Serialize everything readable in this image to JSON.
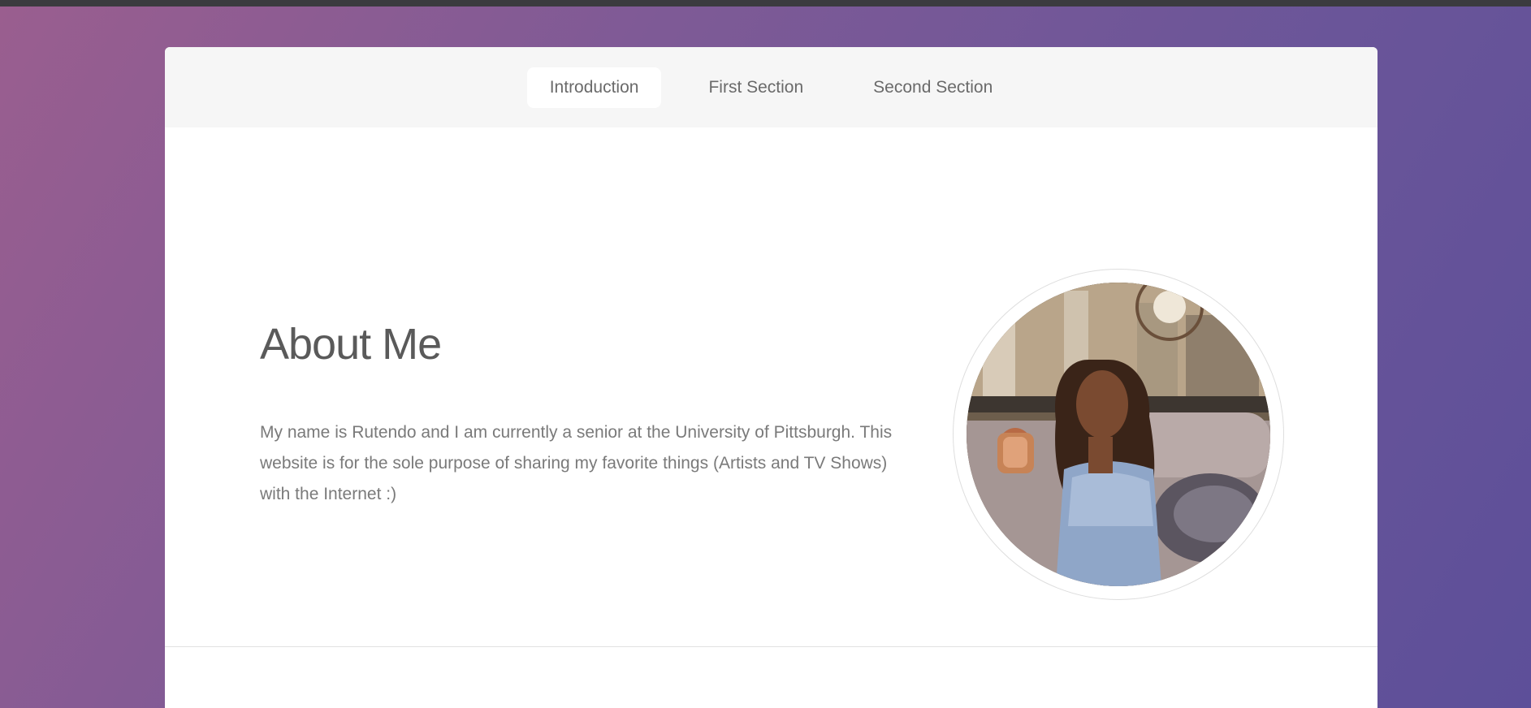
{
  "nav": {
    "items": [
      {
        "label": "Introduction",
        "active": true
      },
      {
        "label": "First Section",
        "active": false
      },
      {
        "label": "Second Section",
        "active": false
      }
    ]
  },
  "intro": {
    "heading": "About Me",
    "bio": "My name is Rutendo and I am currently a senior at the University of Pittsburgh. This website is for the sole purpose of sharing my favorite things (Artists and TV Shows) with the Internet :)"
  },
  "colors": {
    "background_start": "#9a5e8f",
    "background_end": "#5d4f99",
    "card": "#ffffff",
    "nav_bar": "#f6f6f6",
    "text": "#7a7a7a"
  }
}
